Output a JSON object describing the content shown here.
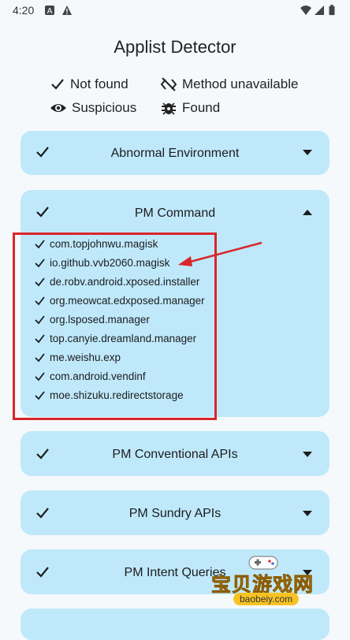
{
  "status_bar": {
    "time": "4:20"
  },
  "app": {
    "title": "Applist Detector"
  },
  "legend": {
    "not_found": "Not found",
    "method_unavailable": "Method unavailable",
    "suspicious": "Suspicious",
    "found": "Found"
  },
  "cards": [
    {
      "title": "Abnormal Environment",
      "expanded": false
    },
    {
      "title": "PM Command",
      "expanded": true,
      "items": [
        "com.topjohnwu.magisk",
        "io.github.vvb2060.magisk",
        "de.robv.android.xposed.installer",
        "org.meowcat.edxposed.manager",
        "org.lsposed.manager",
        "top.canyie.dreamland.manager",
        "me.weishu.exp",
        "com.android.vendinf",
        "moe.shizuku.redirectstorage"
      ]
    },
    {
      "title": "PM Conventional APIs",
      "expanded": false
    },
    {
      "title": "PM Sundry APIs",
      "expanded": false
    },
    {
      "title": "PM Intent Queries",
      "expanded": false
    }
  ],
  "watermark": {
    "cn": "宝贝游戏网",
    "url": "baobeiy.com"
  },
  "colors": {
    "card_bg": "#bfe9fb",
    "annotation_red": "#d9262b",
    "background": "#f6f9fc"
  }
}
